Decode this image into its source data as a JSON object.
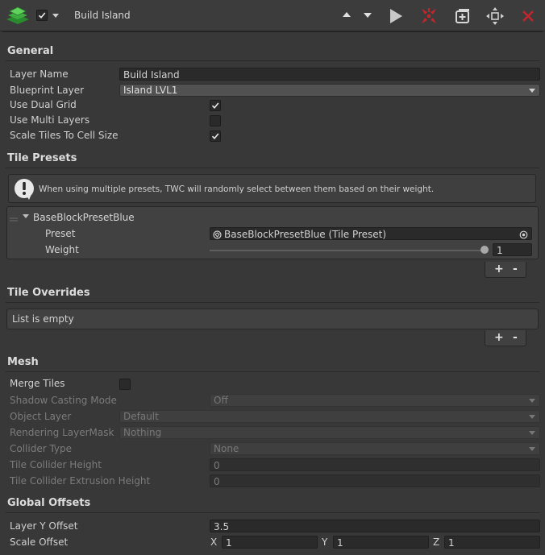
{
  "header": {
    "title": "Build Island",
    "enabled": true,
    "icons": [
      "layer-stack-icon",
      "move-up-icon",
      "move-down-icon",
      "play-icon",
      "scatter-icon",
      "add-layer-icon",
      "move-icon",
      "close-icon"
    ],
    "accent_red": "#c0262d"
  },
  "general": {
    "section_title": "General",
    "layer_name_label": "Layer Name",
    "layer_name_value": "Build Island",
    "blueprint_layer_label": "Blueprint Layer",
    "blueprint_layer_value": "Island LVL1",
    "use_dual_grid_label": "Use Dual Grid",
    "use_dual_grid": true,
    "use_multi_layers_label": "Use Multi Layers",
    "use_multi_layers": false,
    "scale_tiles_label": "Scale Tiles To Cell Size",
    "scale_tiles": true
  },
  "tile_presets": {
    "section_title": "Tile Presets",
    "help_text": "When using multiple presets, TWC will randomly select between them based on their weight.",
    "item_name": "BaseBlockPresetBlue",
    "preset_label": "Preset",
    "preset_value": "BaseBlockPresetBlue (Tile Preset)",
    "weight_label": "Weight",
    "weight_value": "1",
    "weight_fraction": 1.0,
    "add_label": "+",
    "remove_label": "-"
  },
  "tile_overrides": {
    "section_title": "Tile Overrides",
    "empty_text": "List is empty",
    "add_label": "+",
    "remove_label": "-"
  },
  "mesh": {
    "section_title": "Mesh",
    "merge_tiles_label": "Merge Tiles",
    "merge_tiles": false,
    "shadow_casting_label": "Shadow Casting Mode",
    "shadow_casting_value": "Off",
    "object_layer_label": "Object Layer",
    "object_layer_value": "Default",
    "rendering_mask_label": "Rendering LayerMask",
    "rendering_mask_value": "Nothing",
    "collider_type_label": "Collider Type",
    "collider_type_value": "None",
    "collider_height_label": "Tile Collider Height",
    "collider_height_value": "0",
    "collider_extrusion_label": "Tile Collider Extrusion Height",
    "collider_extrusion_value": "0"
  },
  "global_offsets": {
    "section_title": "Global Offsets",
    "layer_y_label": "Layer Y Offset",
    "layer_y_value": "3.5",
    "scale_offset_label": "Scale Offset",
    "x_label": "X",
    "x_value": "1",
    "y_label": "Y",
    "y_value": "1",
    "z_label": "Z",
    "z_value": "1"
  }
}
